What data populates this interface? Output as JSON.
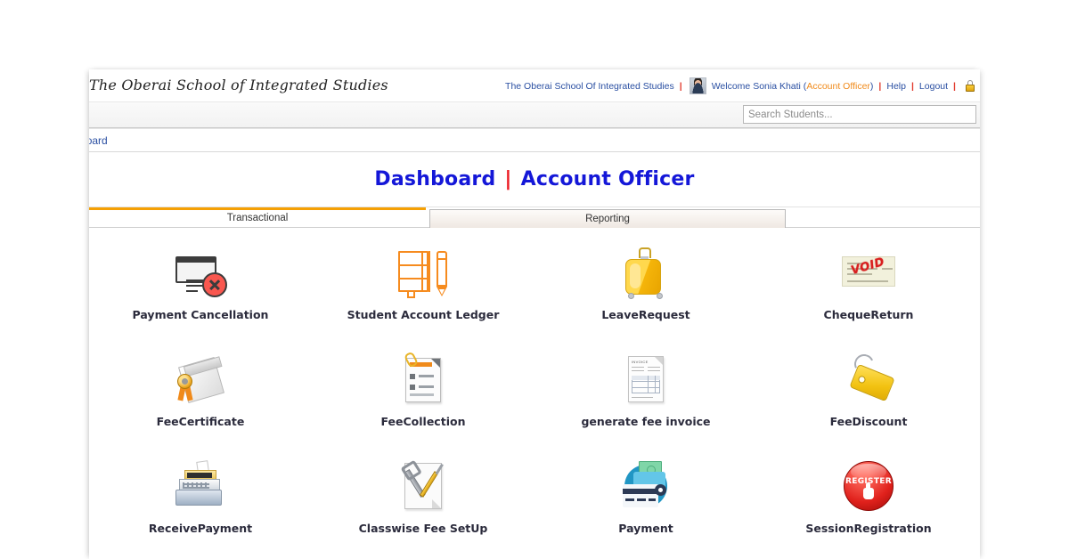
{
  "header": {
    "brand": "The Oberai School of Integrated Studies",
    "school_link": "The Oberai School Of Integrated Studies",
    "welcome_prefix": "Welcome Sonia Khati (",
    "role": "Account Officer",
    "welcome_suffix": ")",
    "help_label": "Help",
    "logout_label": "Logout",
    "separator": "|",
    "avatar_name": "user-avatar",
    "lock_name": "lock-icon"
  },
  "search": {
    "placeholder": "Search Students...",
    "value": ""
  },
  "breadcrumb": {
    "current": "Dashboard"
  },
  "title": {
    "left": "Dashboard",
    "divider": "|",
    "right": "Account Officer"
  },
  "tabs": [
    {
      "label": "Transactional",
      "active": true
    },
    {
      "label": "Reporting",
      "active": false
    }
  ],
  "tiles": [
    {
      "label": "Payment Cancellation",
      "icon": "payment-cancellation-icon"
    },
    {
      "label": "Student Account Ledger",
      "icon": "ledger-notebook-icon"
    },
    {
      "label": "LeaveRequest",
      "icon": "suitcase-icon"
    },
    {
      "label": "ChequeReturn",
      "icon": "cheque-void-icon"
    },
    {
      "label": "FeeCertificate",
      "icon": "certificate-seal-icon"
    },
    {
      "label": "FeeCollection",
      "icon": "document-clip-icon"
    },
    {
      "label": "generate fee invoice",
      "icon": "invoice-document-icon"
    },
    {
      "label": "FeeDiscount",
      "icon": "price-tag-icon"
    },
    {
      "label": "ReceivePayment",
      "icon": "cash-register-icon"
    },
    {
      "label": "Classwise Fee SetUp",
      "icon": "tools-wrench-screwdriver-icon"
    },
    {
      "label": "Payment",
      "icon": "wallet-cards-icon"
    },
    {
      "label": "SessionRegistration",
      "icon": "register-button-icon"
    }
  ],
  "icon_text": {
    "void_stamp": "VOID",
    "register_stamp": "REGISTER",
    "invoice_title": "INVOICE",
    "invoice_soldto": "Sold to",
    "invoice_shipto": "Ship to"
  },
  "colors": {
    "title_blue": "#1417d8",
    "divider_red": "#ec1c24",
    "link_blue": "#2a4fa2",
    "role_orange": "#f08a1a",
    "tab_accent": "#f5a004",
    "icon_orange": "#f68b1e",
    "page_bg": "#ffffff"
  }
}
